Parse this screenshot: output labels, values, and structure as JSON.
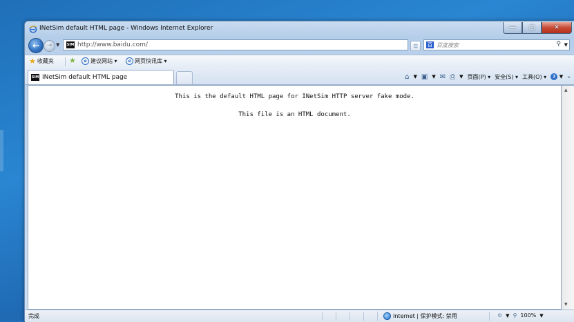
{
  "window": {
    "title": "INetSim default HTML page - Windows Internet Explorer",
    "buttons": {
      "minimize": "—",
      "maximize": "▢",
      "close": "✕"
    }
  },
  "navbar": {
    "address": "http://www.baidu.com/",
    "address_host": "www.baidu.com",
    "site_badge": "SIM",
    "search_placeholder": "百度搜索",
    "search_logo": "百"
  },
  "favorites": {
    "label": "收藏夹",
    "items": [
      {
        "label": "建议网站 ▾"
      },
      {
        "label": "网页快讯库 ▾"
      }
    ]
  },
  "tab": {
    "title": "INetSim default HTML page",
    "badge": "SIM"
  },
  "commandbar": {
    "page": "页面(P) ▾",
    "safety": "安全(S) ▾",
    "tools": "工具(O) ▾",
    "help": "?"
  },
  "content": {
    "line1": "This is the default HTML page for INetSim HTTP server fake mode.",
    "line2": "This file is an HTML document."
  },
  "statusbar": {
    "status": "完成",
    "zone": "Internet | 保护模式: 禁用",
    "zoom": "100%"
  }
}
